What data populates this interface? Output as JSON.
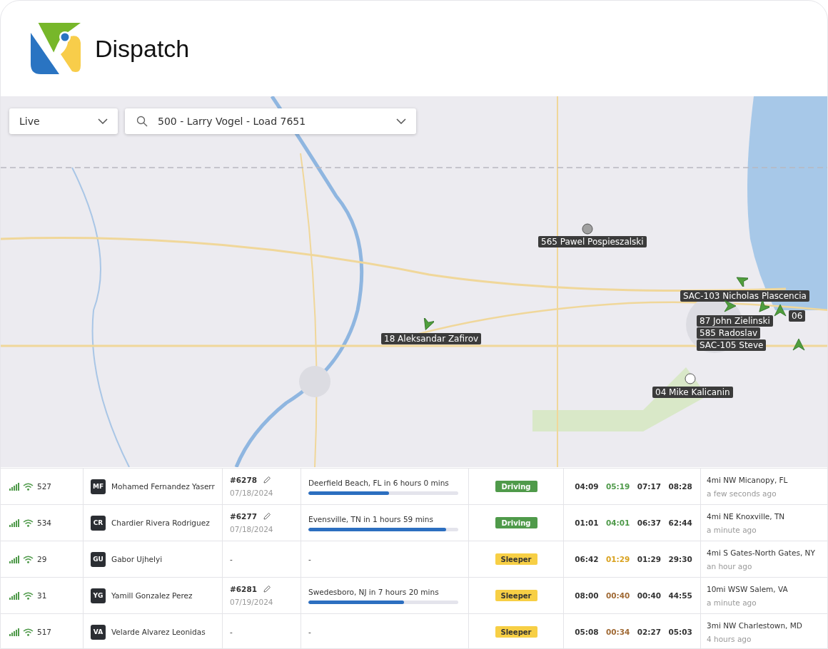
{
  "app": {
    "title": "Dispatch"
  },
  "map_controls": {
    "mode": "Live",
    "search": "500 - Larry Vogel - Load 7651"
  },
  "markers": [
    {
      "kind": "stopped",
      "label": "565 Pawel Pospieszalski"
    },
    {
      "kind": "moving",
      "label": "18 Aleksandar Zafirov"
    },
    {
      "kind": "moving",
      "label": "SAC-103 Nicholas Plascencia"
    },
    {
      "kind": "moving",
      "label": "87 John Zielinski"
    },
    {
      "kind": "moving",
      "label": "585 Radoslav"
    },
    {
      "kind": "moving",
      "label": "06"
    },
    {
      "kind": "moving",
      "label": "SAC-105 Steve"
    },
    {
      "kind": "stopped",
      "label": "04 Mike Kalicanin"
    }
  ],
  "rows": [
    {
      "unit": "527",
      "initials": "MF",
      "driver": "Mohamed Fernandez Yaserr",
      "load": "#6278",
      "date": "07/18/2024",
      "destination": "Deerfield Beach, FL in 6 hours 0 mins",
      "level": 0.54,
      "status": {
        "label": "Driving",
        "color": "#4f9a4a"
      },
      "times": [
        {
          "value": "04:09"
        },
        {
          "value": "05:19",
          "color": "#4f9a4a"
        },
        {
          "value": "07:17"
        },
        {
          "value": "08:28"
        }
      ],
      "location": "4mi NW Micanopy, FL",
      "updated": "a few seconds ago"
    },
    {
      "unit": "534",
      "initials": "CR",
      "driver": "Chardier Rivera Rodriguez",
      "load": "#6277",
      "date": "07/18/2024",
      "destination": "Evensville, TN in 1 hours 59 mins",
      "level": 0.92,
      "status": {
        "label": "Driving",
        "color": "#4f9a4a"
      },
      "times": [
        {
          "value": "01:01"
        },
        {
          "value": "04:01",
          "color": "#4f9a4a"
        },
        {
          "value": "06:37"
        },
        {
          "value": "62:44"
        }
      ],
      "location": "4mi NE Knoxville, TN",
      "updated": "a minute ago"
    },
    {
      "unit": "29",
      "initials": "GU",
      "driver": "Gabor Ujhelyi",
      "load": "-",
      "destination": "-",
      "status": {
        "label": "Sleeper",
        "color": "#f7cf45"
      },
      "times": [
        {
          "value": "06:42"
        },
        {
          "value": "01:29",
          "color": "#d9a21f"
        },
        {
          "value": "01:29"
        },
        {
          "value": "29:30"
        }
      ],
      "location": "4mi S Gates-North Gates, NY",
      "updated": "an hour ago"
    },
    {
      "unit": "31",
      "initials": "YG",
      "driver": "Yamill Gonzalez Perez",
      "load": "#6281",
      "date": "07/19/2024",
      "destination": "Swedesboro, NJ in 7 hours 20 mins",
      "level": 0.64,
      "status": {
        "label": "Sleeper",
        "color": "#f7cf45"
      },
      "times": [
        {
          "value": "08:00"
        },
        {
          "value": "00:40",
          "color": "#a06a35"
        },
        {
          "value": "00:40"
        },
        {
          "value": "44:55"
        }
      ],
      "location": "10mi WSW Salem, VA",
      "updated": "a minute ago"
    },
    {
      "unit": "517",
      "initials": "VA",
      "driver": "Velarde Alvarez Leonidas",
      "load": "-",
      "destination": "-",
      "status": {
        "label": "Sleeper",
        "color": "#f7cf45"
      },
      "times": [
        {
          "value": "05:08"
        },
        {
          "value": "00:34",
          "color": "#a06a35"
        },
        {
          "value": "02:27"
        },
        {
          "value": "05:03"
        }
      ],
      "location": "3mi NW Charlestown, MD",
      "updated": "4 hours ago"
    }
  ]
}
